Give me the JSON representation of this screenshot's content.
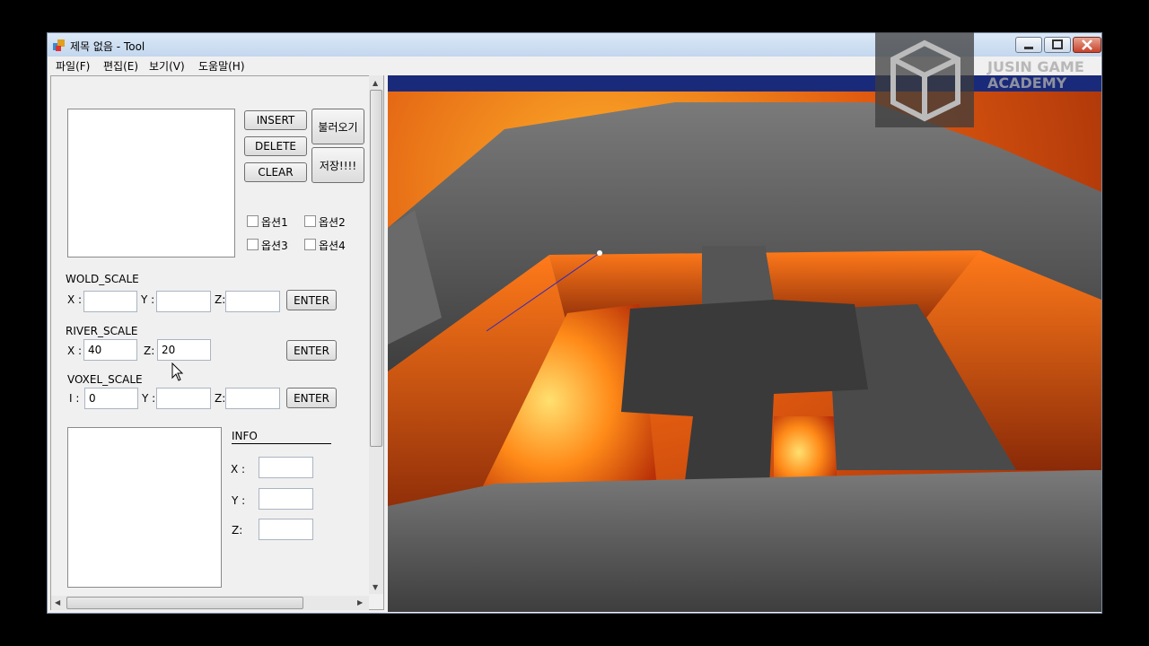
{
  "window": {
    "title": "제목 없음 - Tool"
  },
  "menu": [
    "파일(F)",
    "편집(E)",
    "보기(V)",
    "도움말(H)"
  ],
  "buttons": {
    "insert": "INSERT",
    "delete": "DELETE",
    "clear": "CLEAR",
    "load": "불러오기",
    "save": "저장!!!!"
  },
  "options": [
    "옵션1",
    "옵션2",
    "옵션3",
    "옵션4"
  ],
  "world_scale": {
    "label": "WOLD_SCALE",
    "x_label": "X :",
    "y_label": "Y :",
    "z_label": "Z:",
    "enter": "ENTER"
  },
  "river_scale": {
    "label": "RIVER_SCALE",
    "x_label": "X :",
    "x_value": "40",
    "z_label": "Z:",
    "z_value": "20",
    "enter": "ENTER"
  },
  "voxel_scale": {
    "label": "VOXEL_SCALE",
    "i_label": "I :",
    "i_value": "0",
    "y_label": "Y :",
    "z_label": "Z:",
    "enter": "ENTER"
  },
  "info": {
    "title": "INFO",
    "x_label": "X :",
    "y_label": "Y :",
    "z_label": "Z:"
  },
  "watermark": {
    "line1": "JUSIN GAME",
    "line2": "ACADEMY"
  },
  "colors": {
    "lava": "#e05a10",
    "rock": "#5a5a5a",
    "titlebar": "#c3d7ee"
  }
}
